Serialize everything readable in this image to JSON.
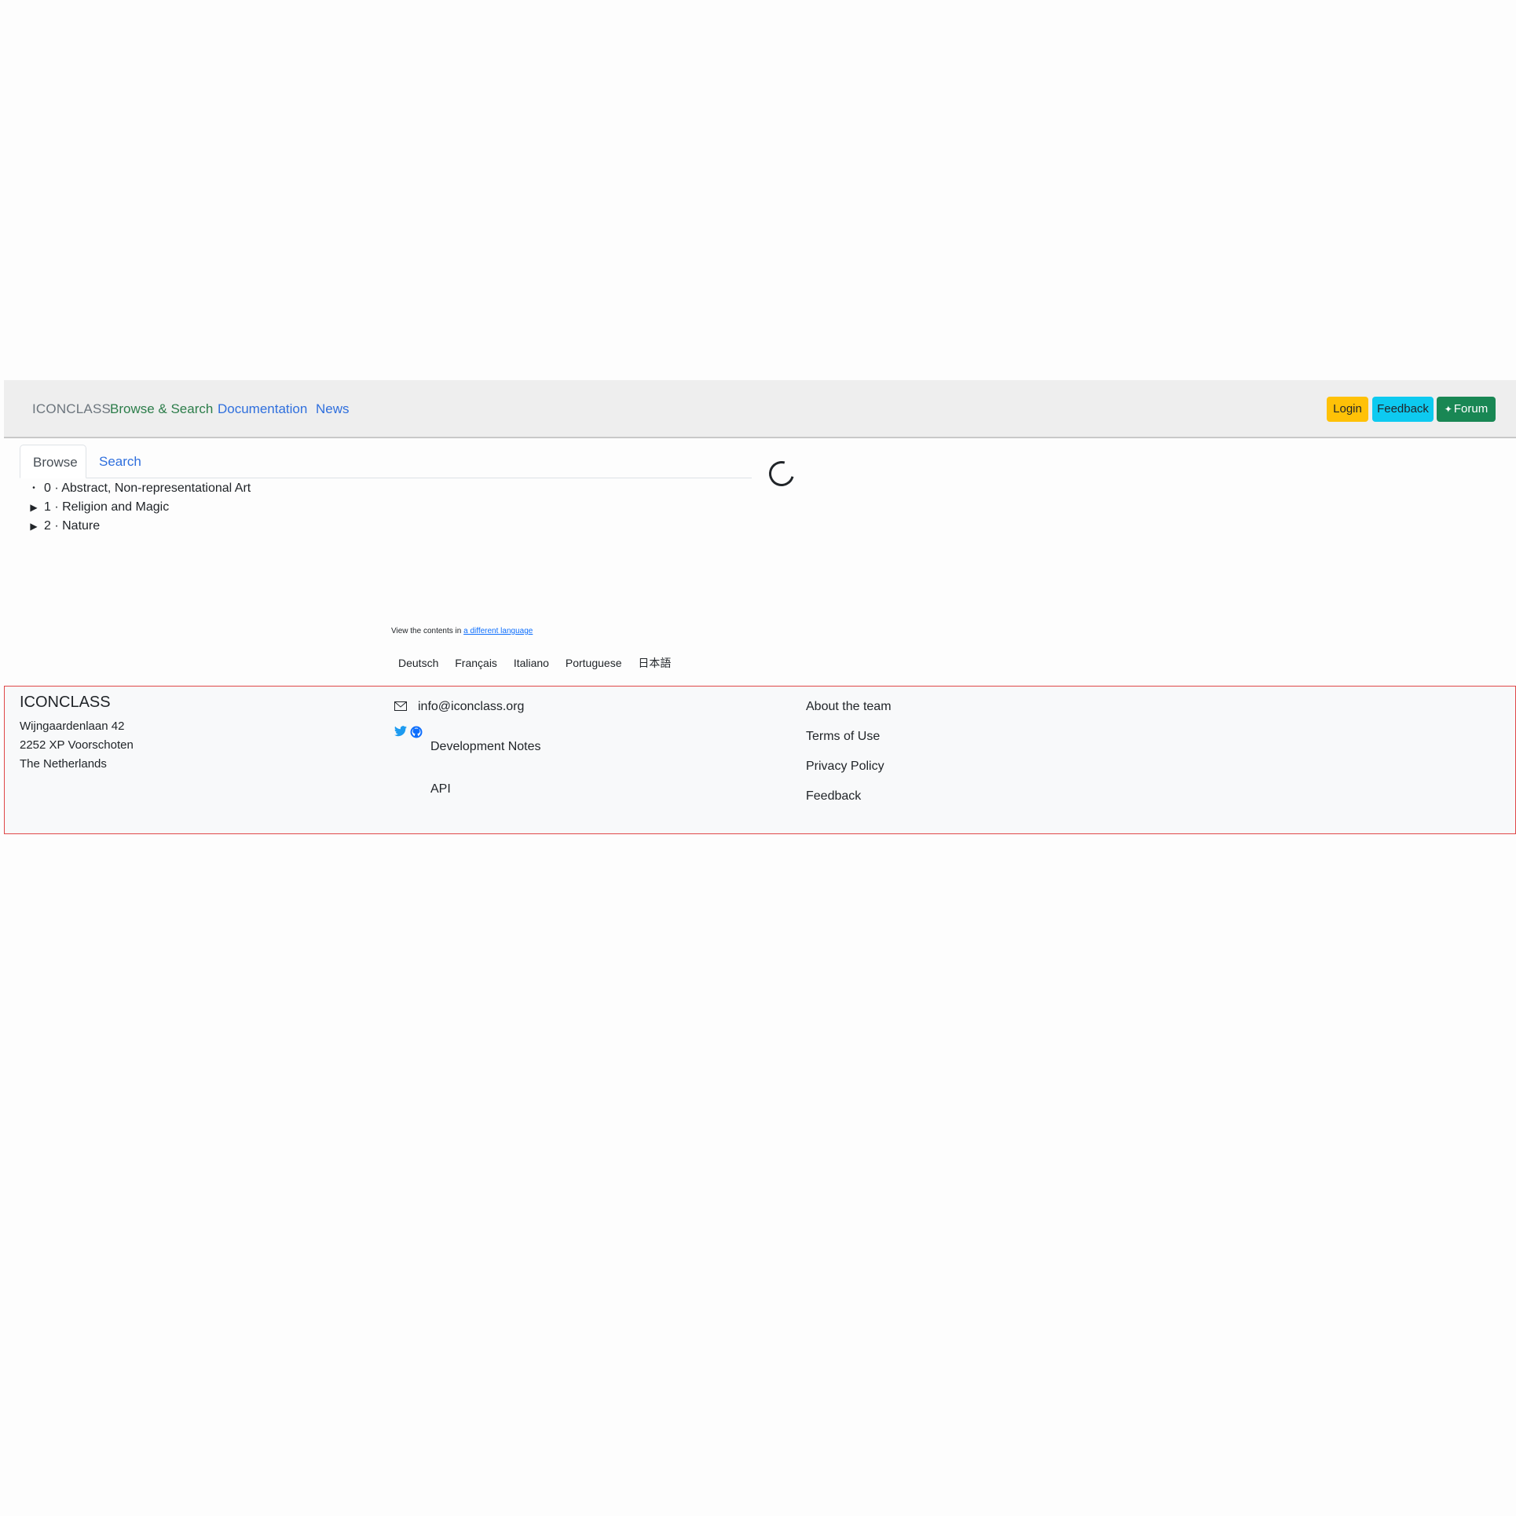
{
  "navbar": {
    "brand": "ICONCLASS",
    "links": [
      "Browse & Search",
      "Documentation",
      "News"
    ],
    "buttons": {
      "login": "Login",
      "feedback": "Feedback",
      "forum": "Forum"
    }
  },
  "tabs": {
    "browse": "Browse",
    "search": "Search"
  },
  "tree": [
    {
      "marker": "•",
      "label": "0 · Abstract, Non-representational Art"
    },
    {
      "marker": "▶",
      "label": "1 · Religion and Magic"
    },
    {
      "marker": "▶",
      "label": "2 · Nature"
    }
  ],
  "language": {
    "note_prefix": "View the contents in ",
    "note_link": "a different language",
    "options": [
      "Deutsch",
      "Français",
      "Italiano",
      "Portuguese",
      "日本語"
    ]
  },
  "footer": {
    "title": "ICONCLASS",
    "address": [
      "Wijngaardenlaan 42",
      "2252 XP Voorschoten",
      "The Netherlands"
    ],
    "email": "info@iconclass.org",
    "sub_links": [
      "Development Notes",
      "API"
    ],
    "right_links": [
      "About the team",
      "Terms of Use",
      "Privacy Policy",
      "Feedback"
    ]
  },
  "colors": {
    "link": "#2f6fdd",
    "active_link": "#2c7d4a",
    "login": "#ffc107",
    "feedback": "#0dcaf0",
    "forum": "#198754"
  }
}
